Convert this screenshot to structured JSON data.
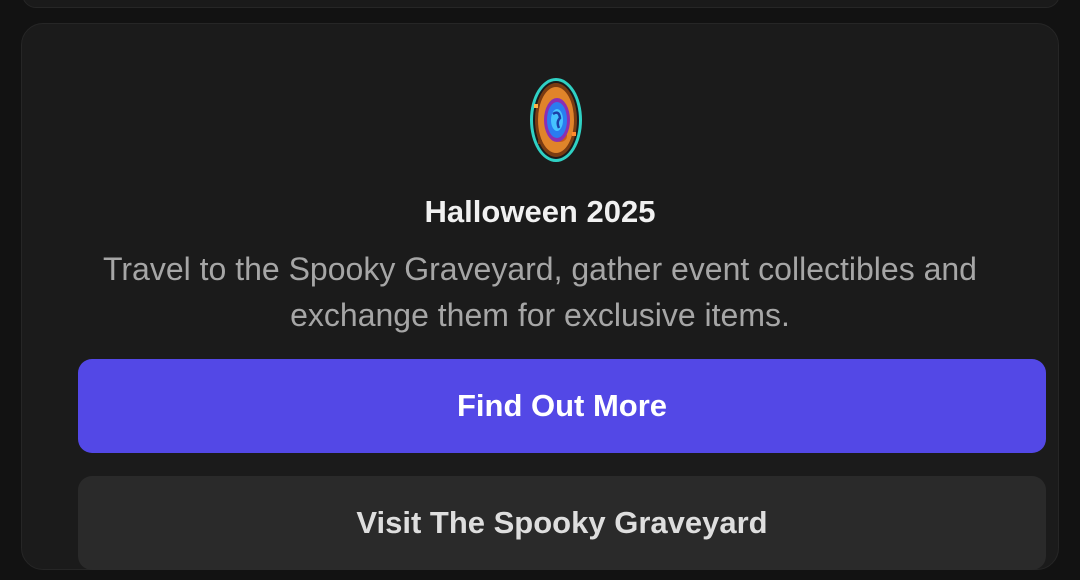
{
  "event": {
    "icon": "halloween-portal-icon",
    "title": "Halloween 2025",
    "description": "Travel to the Spooky Graveyard, gather event collectibles and exchange them for exclusive items."
  },
  "buttons": {
    "find_out_more": "Find Out More",
    "visit": "Visit The Spooky Graveyard"
  },
  "colors": {
    "background": "#121212",
    "card": "#1b1b1b",
    "primary_button": "#5348e6",
    "secondary_button": "#2a2a2a",
    "title_text": "#f1f1f1",
    "description_text": "#a6a6a6"
  }
}
